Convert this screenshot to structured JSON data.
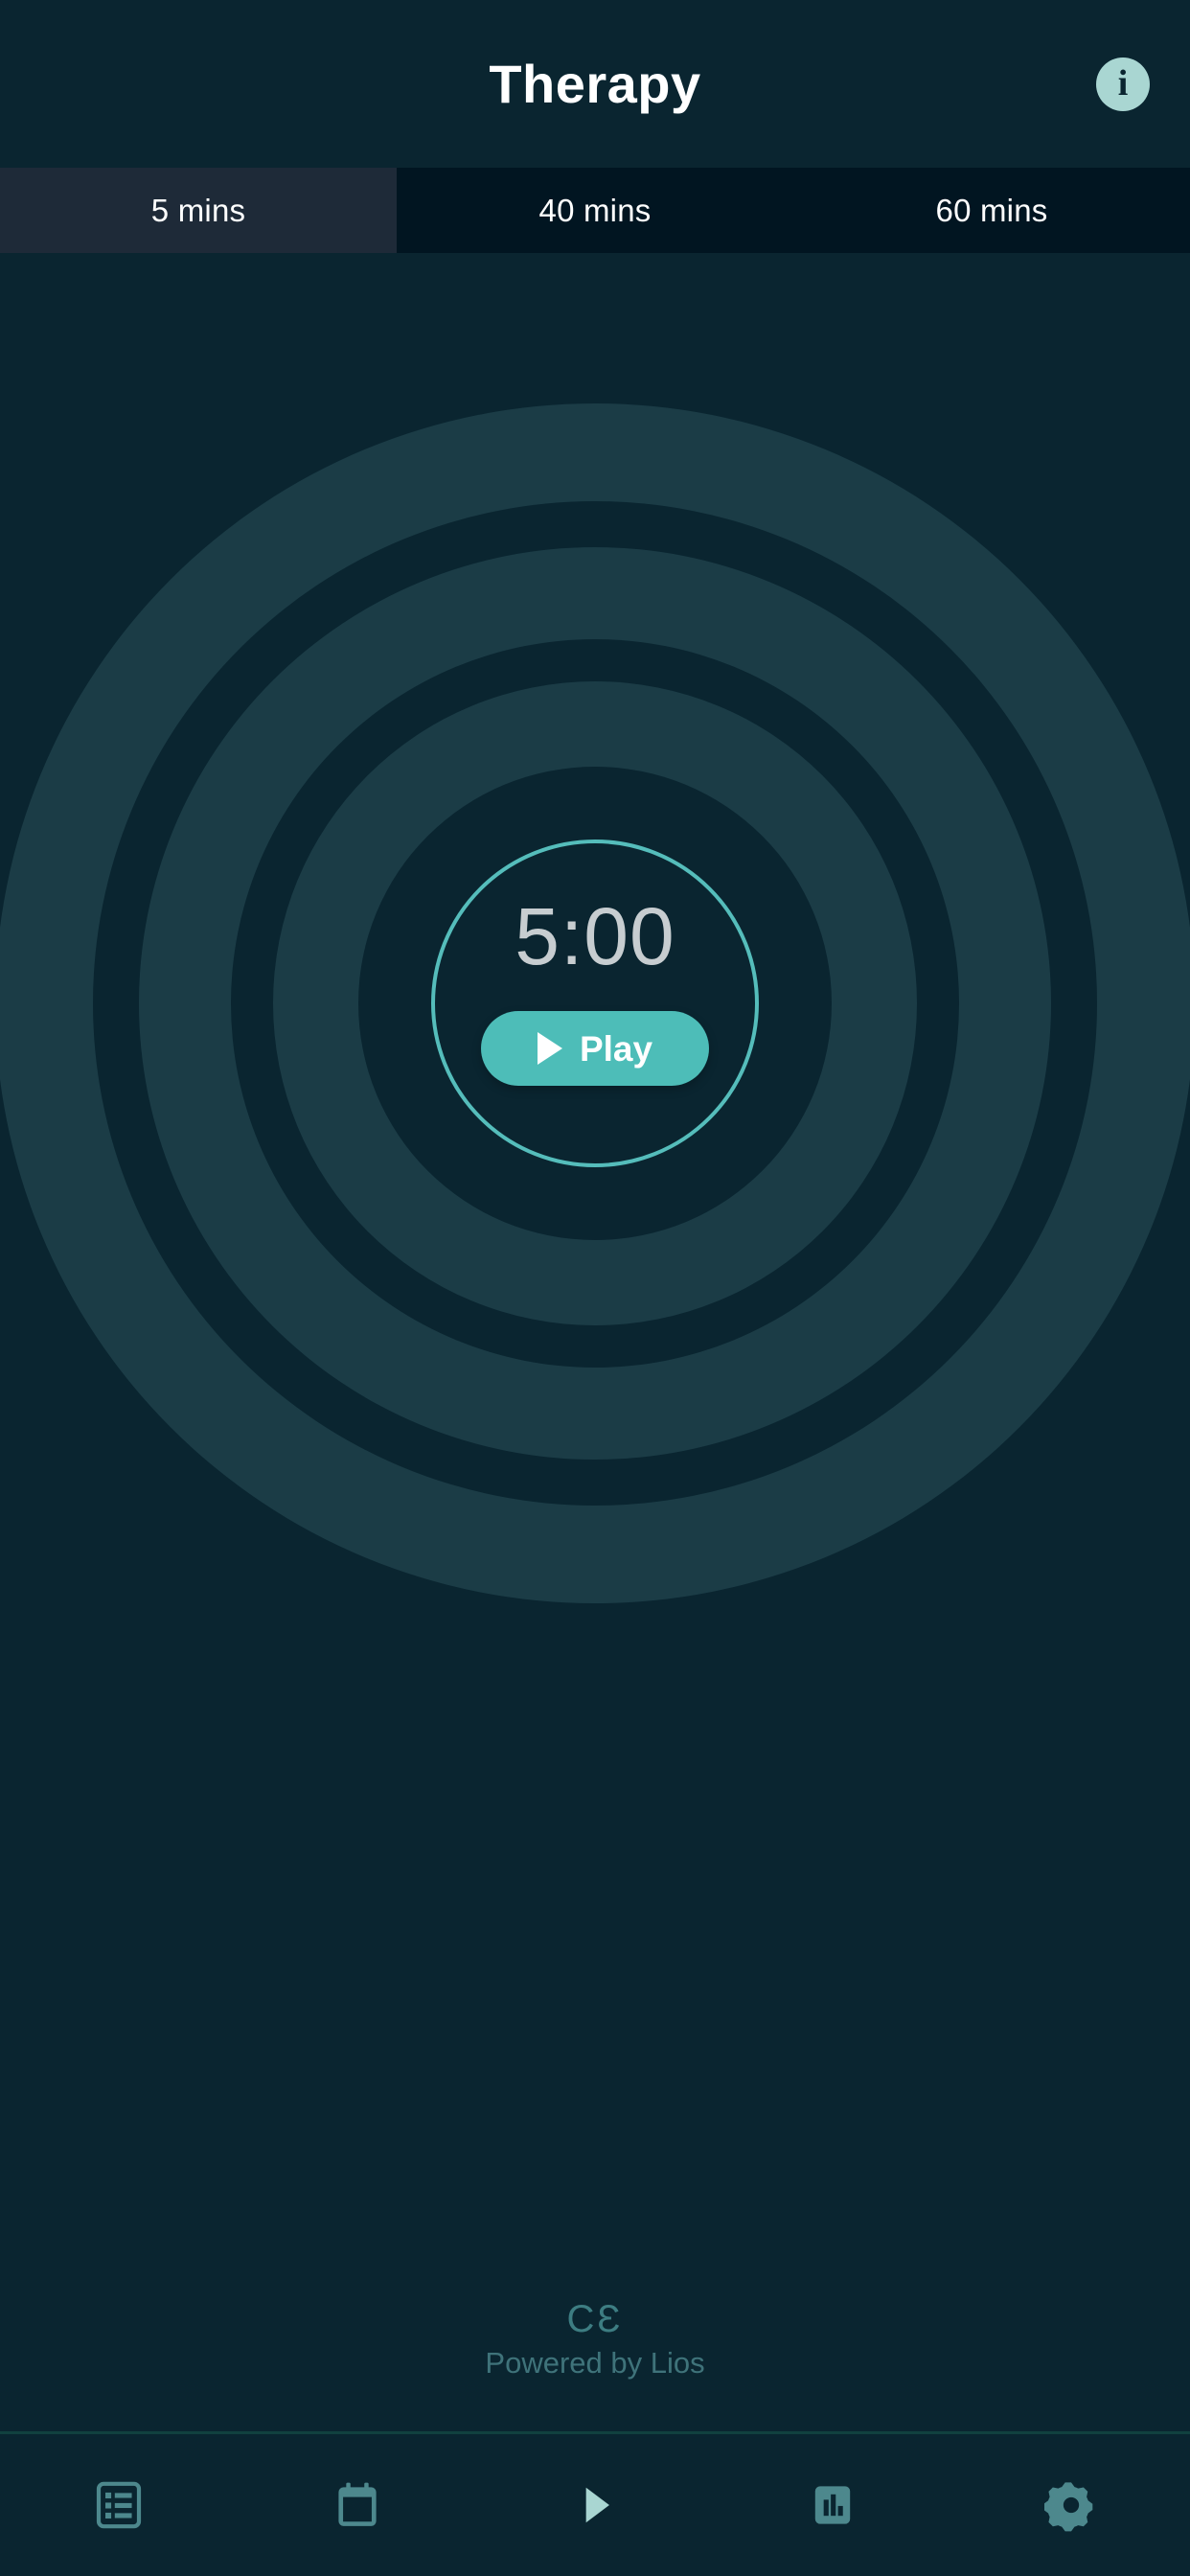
{
  "header": {
    "title": "Therapy",
    "info_icon": "info-icon",
    "info_glyph": "i"
  },
  "tabs": [
    {
      "label": "5 mins",
      "selected": true
    },
    {
      "label": "40 mins",
      "selected": false
    },
    {
      "label": "60 mins",
      "selected": false
    }
  ],
  "timer": {
    "value": "5:00",
    "play_label": "Play",
    "play_icon": "play-icon"
  },
  "footer": {
    "ce_mark": "CƐ",
    "powered_by": "Powered by Lios"
  },
  "nav": [
    {
      "name": "nav-item-list",
      "icon": "list-icon",
      "active": false
    },
    {
      "name": "nav-item-calendar",
      "icon": "calendar-icon",
      "active": false
    },
    {
      "name": "nav-item-play",
      "icon": "play-icon",
      "active": true
    },
    {
      "name": "nav-item-stats",
      "icon": "bar-chart-icon",
      "active": false
    },
    {
      "name": "nav-item-settings",
      "icon": "gear-icon",
      "active": false
    }
  ],
  "colors": {
    "background": "#0a2530",
    "tab_bar_background": "#011521",
    "tab_selected_background": "#1e2a38",
    "accent_teal": "#4dbdb8",
    "ring_teal": "#55bdbb",
    "info_badge": "#a9d6d2",
    "timer_text": "#c7cdd0",
    "nav_icon": "#3f7c82",
    "nav_icon_active": "#a9d6d2",
    "footer_text": "#3f737a",
    "divider": "#11413f"
  }
}
